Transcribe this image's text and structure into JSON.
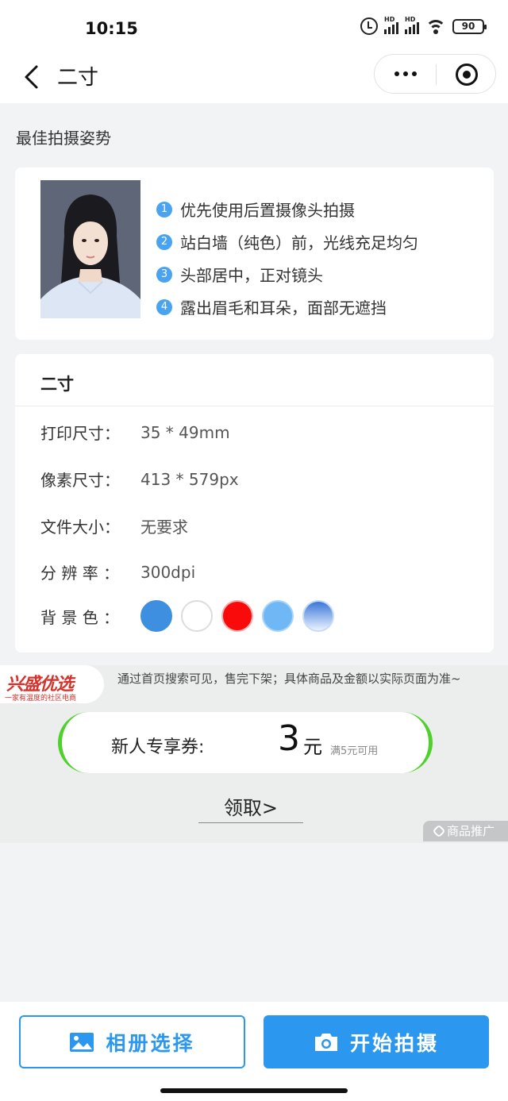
{
  "status_bar": {
    "time": "10:15",
    "battery": "90",
    "network_label": "HD"
  },
  "nav": {
    "title": "二寸"
  },
  "tips_section": {
    "heading": "最佳拍摄姿势",
    "tips": [
      {
        "num": "1",
        "text": "优先使用后置摄像头拍摄"
      },
      {
        "num": "2",
        "text": "站白墙（纯色）前，光线充足均匀"
      },
      {
        "num": "3",
        "text": "头部居中，正对镜头"
      },
      {
        "num": "4",
        "text": "露出眉毛和耳朵，面部无遮挡"
      }
    ]
  },
  "spec": {
    "title": "二寸",
    "rows": [
      {
        "label": "打印尺寸：",
        "value": "35 * 49mm"
      },
      {
        "label": "像素尺寸：",
        "value": "413 * 579px"
      },
      {
        "label": "文件大小：",
        "value": "无要求"
      },
      {
        "label": "分 辨 率 ：",
        "value": "300dpi"
      }
    ],
    "bg_label": "背 景 色 ：",
    "bg_colors": [
      "#3f8fe0",
      "#ffffff",
      "#f90b0b",
      "#6fb8f5",
      "gradient"
    ]
  },
  "ad": {
    "logo_main": "兴盛优选",
    "logo_sub": "一家有温度的社区电商",
    "notice": "通过首页搜索可见，售完下架；具体商品及金额以实际页面为准~",
    "coupon_label": "新人专享券:",
    "coupon_amount": "3",
    "coupon_unit": "元",
    "coupon_condition": "满5元可用",
    "claim": "领取>",
    "promo_tag": "商品推广"
  },
  "actions": {
    "album": "相册选择",
    "shoot": "开始拍摄"
  }
}
